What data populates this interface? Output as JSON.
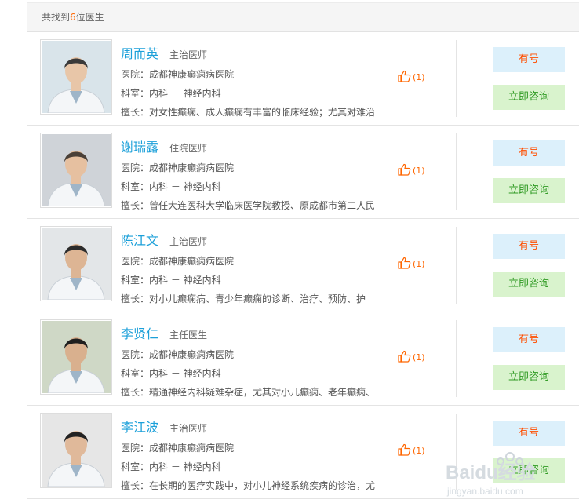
{
  "header": {
    "prefix": "共找到",
    "count": "6",
    "suffix": "位医生"
  },
  "doctors": [
    {
      "name": "周而英",
      "title": "主治医师",
      "hospital": "医院：成都神康癫痫病医院",
      "department": "科室：内科 － 神经内科",
      "specialty": "擅长：对女性癫痫、成人癫痫有丰富的临床经验；尤其对难治",
      "likes": "(1)",
      "availability": "有号",
      "consult": "立即咨询"
    },
    {
      "name": "谢瑞露",
      "title": "住院医师",
      "hospital": "医院：成都神康癫痫病医院",
      "department": "科室：内科 － 神经内科",
      "specialty": "擅长：曾任大连医科大学临床医学院教授、原成都市第二人民",
      "likes": "(1)",
      "availability": "有号",
      "consult": "立即咨询"
    },
    {
      "name": "陈江文",
      "title": "主治医师",
      "hospital": "医院：成都神康癫痫病医院",
      "department": "科室：内科 － 神经内科",
      "specialty": "擅长：对小儿癫痫病、青少年癫痫的诊断、治疗、预防、护",
      "likes": "(1)",
      "availability": "有号",
      "consult": "立即咨询"
    },
    {
      "name": "李贤仁",
      "title": "主任医生",
      "hospital": "医院：成都神康癫痫病医院",
      "department": "科室：内科 － 神经内科",
      "specialty": "擅长：精通神经内科疑难杂症，尤其对小儿癫痫、老年癫痫、",
      "likes": "(1)",
      "availability": "有号",
      "consult": "立即咨询"
    },
    {
      "name": "李江波",
      "title": "主治医师",
      "hospital": "医院：成都神康癫痫病医院",
      "department": "科室：内科 － 神经内科",
      "specialty": "擅长：在长期的医疗实践中，对小儿神经系统疾病的诊治，尤",
      "likes": "(1)",
      "availability": "有号",
      "consult": "立即咨询"
    }
  ],
  "watermark": {
    "brand": "Baidu经验",
    "url": "jingyan.baidu.com"
  },
  "colors": {
    "name_link": "#1ca0d9",
    "accent_orange": "#ff6600",
    "availability_bg": "#dcf0fb",
    "consult_bg": "#d9f3cd",
    "consult_text": "#2e9a22"
  },
  "icons": {
    "like": "thumbs-up-icon",
    "photo": "doctor-photo"
  }
}
